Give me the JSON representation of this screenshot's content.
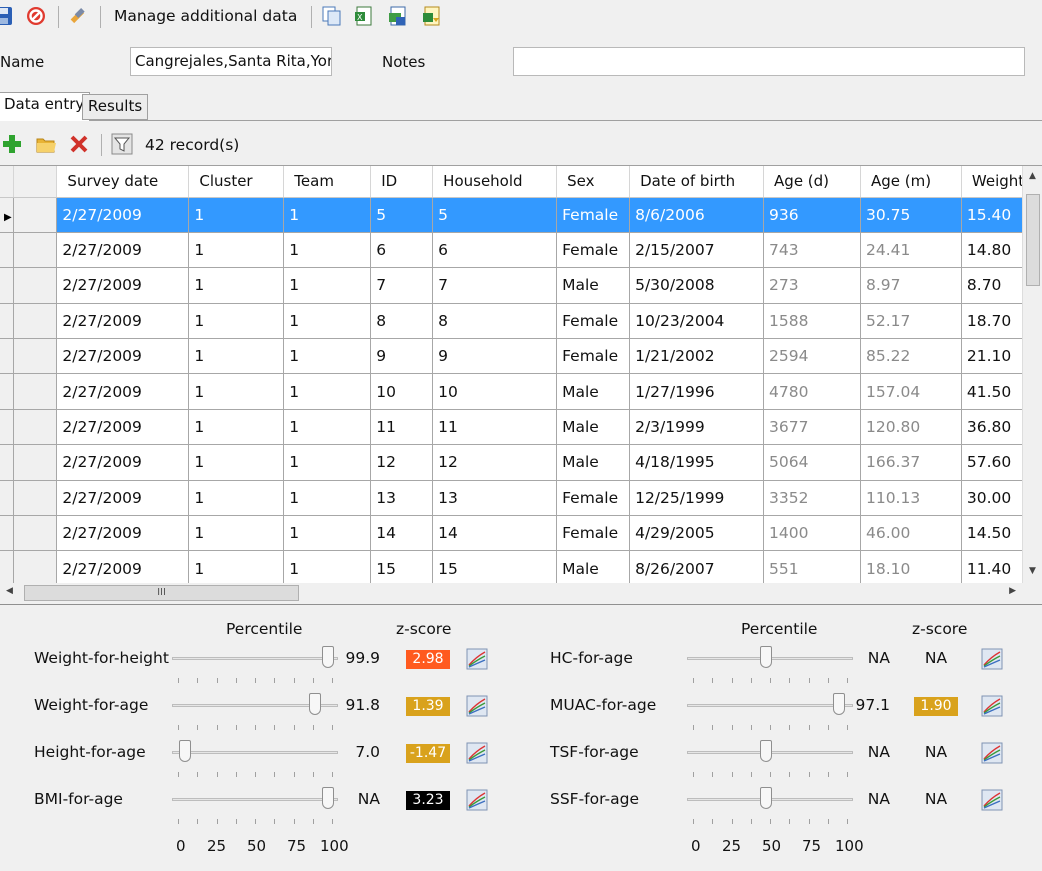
{
  "toolbar": {
    "manage_label": "Manage additional data"
  },
  "form": {
    "name_label": "Name",
    "name_value": "Cangrejales,Santa Rita,Yorc",
    "notes_label": "Notes",
    "notes_value": ""
  },
  "tabs": [
    {
      "label": "Data entry"
    },
    {
      "label": "Results"
    }
  ],
  "records": {
    "count_label": "42 record(s)"
  },
  "table": {
    "columns": [
      "Survey date",
      "Cluster",
      "Team",
      "ID",
      "Household",
      "Sex",
      "Date of birth",
      "Age (d)",
      "Age (m)",
      "Weight"
    ],
    "rows": [
      [
        "2/27/2009",
        "1",
        "1",
        "5",
        "5",
        "Female",
        "8/6/2006",
        "936",
        "30.75",
        "15.40"
      ],
      [
        "2/27/2009",
        "1",
        "1",
        "6",
        "6",
        "Female",
        "2/15/2007",
        "743",
        "24.41",
        "14.80"
      ],
      [
        "2/27/2009",
        "1",
        "1",
        "7",
        "7",
        "Male",
        "5/30/2008",
        "273",
        "8.97",
        "8.70"
      ],
      [
        "2/27/2009",
        "1",
        "1",
        "8",
        "8",
        "Female",
        "10/23/2004",
        "1588",
        "52.17",
        "18.70"
      ],
      [
        "2/27/2009",
        "1",
        "1",
        "9",
        "9",
        "Female",
        "1/21/2002",
        "2594",
        "85.22",
        "21.10"
      ],
      [
        "2/27/2009",
        "1",
        "1",
        "10",
        "10",
        "Male",
        "1/27/1996",
        "4780",
        "157.04",
        "41.50"
      ],
      [
        "2/27/2009",
        "1",
        "1",
        "11",
        "11",
        "Male",
        "2/3/1999",
        "3677",
        "120.80",
        "36.80"
      ],
      [
        "2/27/2009",
        "1",
        "1",
        "12",
        "12",
        "Male",
        "4/18/1995",
        "5064",
        "166.37",
        "57.60"
      ],
      [
        "2/27/2009",
        "1",
        "1",
        "13",
        "13",
        "Female",
        "12/25/1999",
        "3352",
        "110.13",
        "30.00"
      ],
      [
        "2/27/2009",
        "1",
        "1",
        "14",
        "14",
        "Female",
        "4/29/2005",
        "1400",
        "46.00",
        "14.50"
      ],
      [
        "2/27/2009",
        "1",
        "1",
        "15",
        "15",
        "Male",
        "8/26/2007",
        "551",
        "18.10",
        "11.40"
      ]
    ],
    "selected_row": 0
  },
  "scroll": {
    "h_thumb_grip": "III"
  },
  "panel": {
    "percentile_header": "Percentile",
    "zscore_header": "z-score",
    "axis_ticks": [
      "0",
      "25",
      "50",
      "75",
      "100"
    ],
    "left": [
      {
        "label": "Weight-for-height",
        "percentile": "99.9",
        "zscore": "2.98",
        "zcolor": "#ff5a1f",
        "slider_value": 99.9
      },
      {
        "label": "Weight-for-age",
        "percentile": "91.8",
        "zscore": "1.39",
        "zcolor": "#d9a21c",
        "slider_value": 91.8
      },
      {
        "label": "Height-for-age",
        "percentile": "7.0",
        "zscore": "-1.47",
        "zcolor": "#d9a21c",
        "slider_value": 7.0
      },
      {
        "label": "BMI-for-age",
        "percentile": "NA",
        "zscore": "3.23",
        "zcolor": "#000000",
        "slider_value": 100
      }
    ],
    "right": [
      {
        "label": "HC-for-age",
        "percentile": "NA",
        "zscore": "NA",
        "zcolor": "",
        "slider_value": 50
      },
      {
        "label": "MUAC-for-age",
        "percentile": "97.1",
        "zscore": "1.90",
        "zcolor": "#d9a21c",
        "slider_value": 97.1
      },
      {
        "label": "TSF-for-age",
        "percentile": "NA",
        "zscore": "NA",
        "zcolor": "",
        "slider_value": 50
      },
      {
        "label": "SSF-for-age",
        "percentile": "NA",
        "zscore": "NA",
        "zcolor": "",
        "slider_value": 50
      }
    ]
  }
}
